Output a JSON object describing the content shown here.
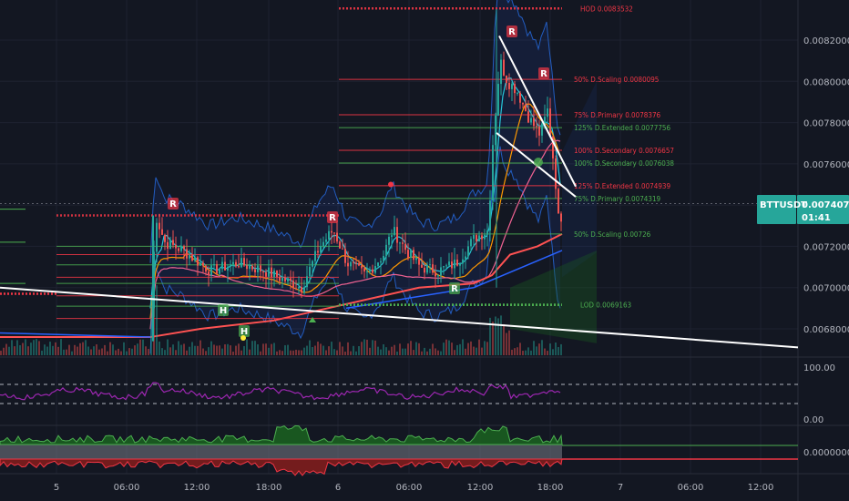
{
  "chart_data": {
    "type": "candlestick",
    "symbol": "BTTUSDT",
    "last_price": "0.0074074",
    "countdown": "01:41",
    "x_ticks": [
      "5",
      "06:00",
      "12:00",
      "18:00",
      "6",
      "06:00",
      "12:00",
      "18:00",
      "7",
      "06:00",
      "12:00"
    ],
    "y_ticks": [
      "0.0082000",
      "0.0080000",
      "0.0078000",
      "0.0076000",
      "0.0072000",
      "0.0070000",
      "0.0068000"
    ],
    "ylim": [
      0.00664,
      0.00835
    ],
    "rsi_ticks": [
      "100.00",
      "0.00"
    ],
    "osc_ticks": [
      "0.0000000"
    ],
    "levels": [
      {
        "label": "HOD",
        "value": "0.0083532",
        "v": 0.0083532,
        "color": "#f23645"
      },
      {
        "label": "50% D.Scaling",
        "value": "0.0080095",
        "v": 0.0080095,
        "color": "#f23645"
      },
      {
        "label": "75% D.Primary",
        "value": "0.0078376",
        "v": 0.0078376,
        "color": "#f23645"
      },
      {
        "label": "125% D.Extended",
        "value": "0.0077756",
        "v": 0.0077756,
        "color": "#4caf50"
      },
      {
        "label": "100% D.Secondary",
        "value": "0.0076657",
        "v": 0.0076657,
        "color": "#f23645"
      },
      {
        "label": "100% D.Secondary",
        "value": "0.0076038",
        "v": 0.0076038,
        "color": "#4caf50"
      },
      {
        "label": "125% D.Extended",
        "value": "0.0074939",
        "v": 0.0074939,
        "color": "#f23645"
      },
      {
        "label": "75% D.Primary",
        "value": "0.0074319",
        "v": 0.0074319,
        "color": "#4caf50"
      },
      {
        "label": "50% D.Scaling",
        "value": "0.00726",
        "v": 0.00726,
        "color": "#4caf50"
      },
      {
        "label": "LOD",
        "value": "0.0069163",
        "v": 0.0069163,
        "color": "#4caf50"
      }
    ],
    "markers": [
      {
        "text": "R",
        "kind": "resistance"
      },
      {
        "text": "R",
        "kind": "resistance"
      },
      {
        "text": "R",
        "kind": "resistance"
      },
      {
        "text": "R",
        "kind": "resistance"
      },
      {
        "text": "R",
        "kind": "support"
      },
      {
        "text": "H",
        "kind": "support"
      },
      {
        "text": "H",
        "kind": "support"
      }
    ],
    "colors": {
      "up": "#26a69a",
      "down": "#ef5350",
      "background": "#131722",
      "rsi": "#9c27b0",
      "bands": "#2962ff"
    }
  }
}
